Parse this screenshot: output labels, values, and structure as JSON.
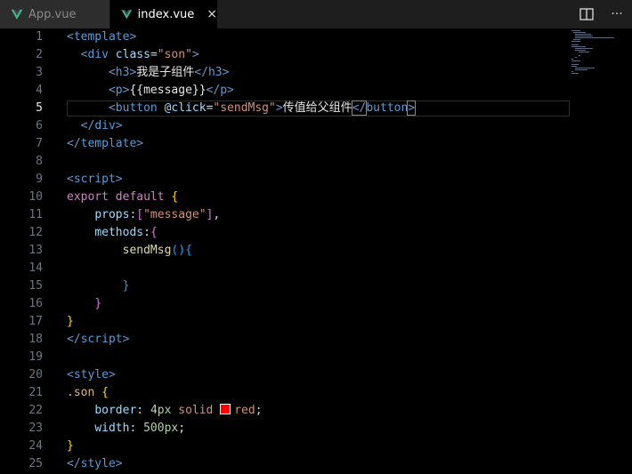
{
  "tabs": [
    {
      "label": "App.vue",
      "active": false
    },
    {
      "label": "index.vue",
      "active": true,
      "close": "×"
    }
  ],
  "toolbar": {
    "split_icon": "split-editor-icon",
    "more_icon": "more-actions-icon",
    "more_label": "···"
  },
  "colors": {
    "vue_green": "#41b883",
    "vue_dark": "#34495e",
    "swatch_red": "#ff0000"
  },
  "editor": {
    "active_line": 5,
    "line_numbers": [
      "1",
      "2",
      "3",
      "4",
      "5",
      "6",
      "7",
      "8",
      "9",
      "10",
      "11",
      "12",
      "13",
      "14",
      "15",
      "16",
      "17",
      "18",
      "19",
      "20",
      "21",
      "22",
      "23",
      "24",
      "25"
    ],
    "lines": {
      "l1": {
        "open": "<",
        "name": "template",
        "close": ">"
      },
      "l2": {
        "open": "<",
        "name": "div",
        "attr": "class",
        "eq": "=",
        "val": "\"son\"",
        "close": ">"
      },
      "l3": {
        "open": "<",
        "name": "h3",
        "close": ">",
        "text": "我是子组件",
        "end_open": "</",
        "end_name": "h3",
        "end_close": ">"
      },
      "l4": {
        "open": "<",
        "name": "p",
        "close": ">",
        "text": "{{message}}",
        "end_open": "</",
        "end_name": "p",
        "end_close": ">"
      },
      "l5": {
        "open": "<",
        "name": "button",
        "attr": "@click",
        "eq": "=",
        "val": "\"sendMsg\"",
        "close": ">",
        "text": "传值给父组件",
        "end_open": "</",
        "end_name": "button",
        "end_close": ">"
      },
      "l6": {
        "open": "</",
        "name": "div",
        "close": ">"
      },
      "l7": {
        "open": "</",
        "name": "template",
        "close": ">"
      },
      "l9": {
        "open": "<",
        "name": "script",
        "close": ">"
      },
      "l10": {
        "kw1": "export",
        "kw2": "default",
        "brace": "{"
      },
      "l11": {
        "prop": "props",
        "colon": ":",
        "br": "[",
        "str": "\"message\"",
        "br_close": "]",
        "comma": ","
      },
      "l12": {
        "prop": "methods",
        "colon": ":",
        "brace": "{"
      },
      "l13": {
        "fn": "sendMsg",
        "paren": "()",
        "brace": "{"
      },
      "l15": {
        "brace": "}"
      },
      "l16": {
        "brace": "}"
      },
      "l17": {
        "brace": "}"
      },
      "l18": {
        "open": "</",
        "name": "script",
        "close": ">"
      },
      "l20": {
        "open": "<",
        "name": "style",
        "close": ">"
      },
      "l21": {
        "sel": ".son",
        "brace": "{"
      },
      "l22": {
        "prop": "border",
        "colon": ":",
        "num": "4px",
        "kw": "solid",
        "color": "red",
        "semi": ";"
      },
      "l23": {
        "prop": "width",
        "colon": ":",
        "num": "500px",
        "semi": ";"
      },
      "l24": {
        "brace": "}"
      },
      "l25": {
        "open": "</",
        "name": "style",
        "close": ">"
      }
    }
  }
}
